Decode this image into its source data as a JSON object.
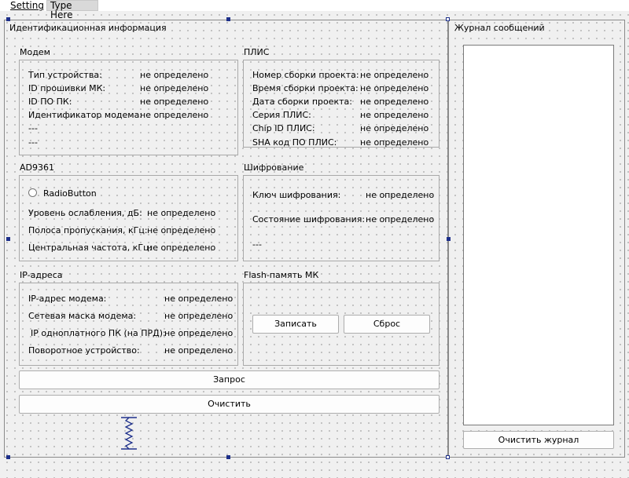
{
  "menu": {
    "setting": "Setting",
    "type_here": "Type Here"
  },
  "main": {
    "title": "Идентификационная информация"
  },
  "modem": {
    "title": "Модем",
    "rows": [
      {
        "label": "Тип устройства:",
        "value": "не определено"
      },
      {
        "label": "ID прошивки МК:",
        "value": "не определено"
      },
      {
        "label": "ID ПО ПК:",
        "value": "не определено"
      },
      {
        "label": "Идентификатор модема:",
        "value": "не определено"
      },
      {
        "label": "---",
        "value": ""
      },
      {
        "label": "---",
        "value": ""
      }
    ]
  },
  "plis": {
    "title": "ПЛИС",
    "rows": [
      {
        "label": "Номер сборки проекта:",
        "value": "не определено"
      },
      {
        "label": "Время сборки проекта:",
        "value": "не определено"
      },
      {
        "label": "Дата сборки проекта:",
        "value": "не определено"
      },
      {
        "label": "Серия ПЛИС:",
        "value": "не определено"
      },
      {
        "label": "Chip ID ПЛИС:",
        "value": "не определено"
      },
      {
        "label": "SHA код ПО ПЛИС:",
        "value": "не определено"
      }
    ]
  },
  "ad9361": {
    "title": "AD9361",
    "radio_label": "RadioButton",
    "rows": [
      {
        "label": "Уровень ослабления, дБ:",
        "value": "не определено"
      },
      {
        "label": "Полоса пропускания, кГц:",
        "value": "не определено"
      },
      {
        "label": "Центральная частота, кГц:",
        "value": "не определено"
      }
    ]
  },
  "crypto": {
    "title": "Шифрование",
    "rows": [
      {
        "label": "Ключ шифрования:",
        "value": "не определено"
      },
      {
        "label": "Состояние шифрования:",
        "value": "не определено"
      },
      {
        "label": "---",
        "value": ""
      }
    ]
  },
  "ip": {
    "title": "IP-адреса",
    "rows": [
      {
        "label": "IP-адрес модема:",
        "value": "не определено"
      },
      {
        "label": "Сетевая маска модема:",
        "value": "не определено"
      },
      {
        "label": "IP одноплатного ПК (на ПРД):",
        "value": "не определено"
      },
      {
        "label": "Поворотное устройство:",
        "value": "не определено"
      }
    ]
  },
  "flash": {
    "title": "Flash-память МК",
    "write_label": "Записать",
    "reset_label": "Сброс"
  },
  "actions": {
    "request_label": "Запрос",
    "clear_label": "Очистить"
  },
  "log": {
    "title": "Журнал сообщений",
    "clear_label": "Очистить журнал"
  }
}
